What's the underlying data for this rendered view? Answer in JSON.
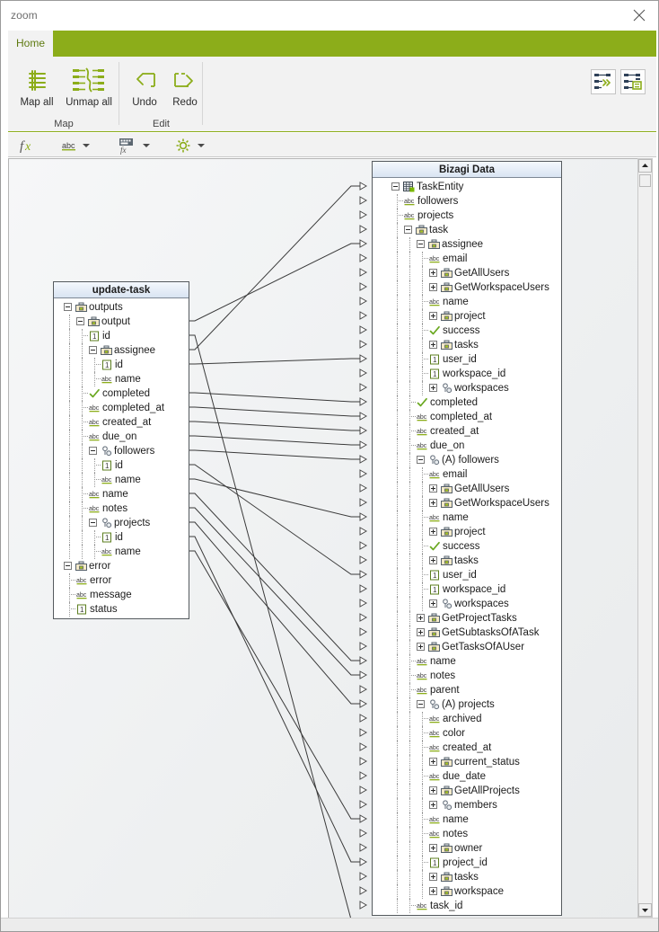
{
  "window": {
    "title": "zoom",
    "close_label": "close-window"
  },
  "ribbon": {
    "tabs": [
      {
        "label": "Home",
        "active": true
      }
    ],
    "groups": [
      {
        "title": "Map",
        "buttons": [
          {
            "label": "Map all",
            "icon": "map-all-icon"
          },
          {
            "label": "Unmap all",
            "icon": "unmap-all-icon"
          }
        ]
      },
      {
        "title": "Edit",
        "buttons": [
          {
            "label": "Undo",
            "icon": "undo-icon"
          },
          {
            "label": "Redo",
            "icon": "redo-icon"
          }
        ]
      }
    ],
    "right_buttons": [
      {
        "icon": "auto-map-icon"
      },
      {
        "icon": "show-grid-icon"
      }
    ]
  },
  "toolstrip": {
    "items": [
      {
        "icon": "fx-icon",
        "has_caret": false
      },
      {
        "icon": "abc-text-icon",
        "has_caret": true
      },
      {
        "icon": "expression-icon",
        "has_caret": true
      },
      {
        "icon": "gear-icon",
        "has_caret": true
      }
    ]
  },
  "source_panel": {
    "title": "update-task",
    "rows": [
      {
        "label": "outputs",
        "depth": 0,
        "icon": "briefcase",
        "toggle": "minus",
        "last": false
      },
      {
        "label": "output",
        "depth": 1,
        "icon": "briefcase",
        "toggle": "minus",
        "last": false
      },
      {
        "label": "id",
        "depth": 2,
        "icon": "number",
        "toggle": "none",
        "last": false
      },
      {
        "label": "assignee",
        "depth": 2,
        "icon": "briefcase",
        "toggle": "minus",
        "last": false
      },
      {
        "label": "id",
        "depth": 3,
        "icon": "number",
        "toggle": "none",
        "last": false
      },
      {
        "label": "name",
        "depth": 3,
        "icon": "abc",
        "toggle": "none",
        "last": true
      },
      {
        "label": "completed",
        "depth": 2,
        "icon": "check",
        "toggle": "none",
        "last": false
      },
      {
        "label": "completed_at",
        "depth": 2,
        "icon": "abc",
        "toggle": "none",
        "last": false
      },
      {
        "label": "created_at",
        "depth": 2,
        "icon": "abc",
        "toggle": "none",
        "last": false
      },
      {
        "label": "due_on",
        "depth": 2,
        "icon": "abc",
        "toggle": "none",
        "last": false
      },
      {
        "label": "followers",
        "depth": 2,
        "icon": "people",
        "toggle": "minus",
        "last": false
      },
      {
        "label": "id",
        "depth": 3,
        "icon": "number",
        "toggle": "none",
        "last": false
      },
      {
        "label": "name",
        "depth": 3,
        "icon": "abc",
        "toggle": "none",
        "last": true
      },
      {
        "label": "name",
        "depth": 2,
        "icon": "abc",
        "toggle": "none",
        "last": false
      },
      {
        "label": "notes",
        "depth": 2,
        "icon": "abc",
        "toggle": "none",
        "last": true
      },
      {
        "label": "projects",
        "depth": 2,
        "icon": "people",
        "toggle": "minus",
        "last": false
      },
      {
        "label": "id",
        "depth": 3,
        "icon": "number",
        "toggle": "none",
        "last": false
      },
      {
        "label": "name",
        "depth": 3,
        "icon": "abc",
        "toggle": "none",
        "last": true
      },
      {
        "label": "error",
        "depth": 0,
        "icon": "briefcase",
        "toggle": "minus",
        "last": false
      },
      {
        "label": "error",
        "depth": 1,
        "icon": "abc",
        "toggle": "none",
        "last": false
      },
      {
        "label": "message",
        "depth": 1,
        "icon": "abc",
        "toggle": "none",
        "last": false
      },
      {
        "label": "status",
        "depth": 1,
        "icon": "number",
        "toggle": "none",
        "last": true
      }
    ]
  },
  "target_panel": {
    "title": "Bizagi Data",
    "rows": [
      {
        "label": "TaskEntity",
        "depth": 0,
        "icon": "entity",
        "toggle": "minus",
        "last": false
      },
      {
        "label": "followers",
        "depth": 1,
        "icon": "abc",
        "toggle": "none",
        "last": false
      },
      {
        "label": "projects",
        "depth": 1,
        "icon": "abc",
        "toggle": "none",
        "last": true
      },
      {
        "label": "task",
        "depth": 1,
        "icon": "briefcase",
        "toggle": "minus",
        "last": false
      },
      {
        "label": "assignee",
        "depth": 2,
        "icon": "briefcase",
        "toggle": "minus",
        "last": false
      },
      {
        "label": "email",
        "depth": 3,
        "icon": "abc",
        "toggle": "none",
        "last": false
      },
      {
        "label": "GetAllUsers",
        "depth": 3,
        "icon": "briefcase",
        "toggle": "plus",
        "last": false
      },
      {
        "label": "GetWorkspaceUsers",
        "depth": 3,
        "icon": "briefcase",
        "toggle": "plus",
        "last": false
      },
      {
        "label": "name",
        "depth": 3,
        "icon": "abc",
        "toggle": "none",
        "last": false
      },
      {
        "label": "project",
        "depth": 3,
        "icon": "briefcase",
        "toggle": "plus",
        "last": false
      },
      {
        "label": "success",
        "depth": 3,
        "icon": "check",
        "toggle": "none",
        "last": false
      },
      {
        "label": "tasks",
        "depth": 3,
        "icon": "briefcase",
        "toggle": "plus",
        "last": false
      },
      {
        "label": "user_id",
        "depth": 3,
        "icon": "number",
        "toggle": "none",
        "last": false
      },
      {
        "label": "workspace_id",
        "depth": 3,
        "icon": "number",
        "toggle": "none",
        "last": true
      },
      {
        "label": "workspaces",
        "depth": 3,
        "icon": "people",
        "toggle": "plus",
        "last": false
      },
      {
        "label": "completed",
        "depth": 2,
        "icon": "check",
        "toggle": "none",
        "last": false
      },
      {
        "label": "completed_at",
        "depth": 2,
        "icon": "abc",
        "toggle": "none",
        "last": false
      },
      {
        "label": "created_at",
        "depth": 2,
        "icon": "abc",
        "toggle": "none",
        "last": false
      },
      {
        "label": "due_on",
        "depth": 2,
        "icon": "abc",
        "toggle": "none",
        "last": false
      },
      {
        "label": "(A) followers",
        "depth": 2,
        "icon": "people",
        "toggle": "minus",
        "last": false
      },
      {
        "label": "email",
        "depth": 3,
        "icon": "abc",
        "toggle": "none",
        "last": false
      },
      {
        "label": "GetAllUsers",
        "depth": 3,
        "icon": "briefcase",
        "toggle": "plus",
        "last": false
      },
      {
        "label": "GetWorkspaceUsers",
        "depth": 3,
        "icon": "briefcase",
        "toggle": "plus",
        "last": false
      },
      {
        "label": "name",
        "depth": 3,
        "icon": "abc",
        "toggle": "none",
        "last": false
      },
      {
        "label": "project",
        "depth": 3,
        "icon": "briefcase",
        "toggle": "plus",
        "last": false
      },
      {
        "label": "success",
        "depth": 3,
        "icon": "check",
        "toggle": "none",
        "last": false
      },
      {
        "label": "tasks",
        "depth": 3,
        "icon": "briefcase",
        "toggle": "plus",
        "last": false
      },
      {
        "label": "user_id",
        "depth": 3,
        "icon": "number",
        "toggle": "none",
        "last": false
      },
      {
        "label": "workspace_id",
        "depth": 3,
        "icon": "number",
        "toggle": "none",
        "last": true
      },
      {
        "label": "workspaces",
        "depth": 3,
        "icon": "people",
        "toggle": "plus",
        "last": false
      },
      {
        "label": "GetProjectTasks",
        "depth": 2,
        "icon": "briefcase",
        "toggle": "plus",
        "last": false
      },
      {
        "label": "GetSubtasksOfATask",
        "depth": 2,
        "icon": "briefcase",
        "toggle": "plus",
        "last": false
      },
      {
        "label": "GetTasksOfAUser",
        "depth": 2,
        "icon": "briefcase",
        "toggle": "plus",
        "last": false
      },
      {
        "label": "name",
        "depth": 2,
        "icon": "abc",
        "toggle": "none",
        "last": false
      },
      {
        "label": "notes",
        "depth": 2,
        "icon": "abc",
        "toggle": "none",
        "last": false
      },
      {
        "label": "parent",
        "depth": 2,
        "icon": "abc",
        "toggle": "none",
        "last": false
      },
      {
        "label": "(A) projects",
        "depth": 2,
        "icon": "people",
        "toggle": "minus",
        "last": false
      },
      {
        "label": "archived",
        "depth": 3,
        "icon": "abc",
        "toggle": "none",
        "last": false
      },
      {
        "label": "color",
        "depth": 3,
        "icon": "abc",
        "toggle": "none",
        "last": false
      },
      {
        "label": "created_at",
        "depth": 3,
        "icon": "abc",
        "toggle": "none",
        "last": false
      },
      {
        "label": "current_status",
        "depth": 3,
        "icon": "briefcase",
        "toggle": "plus",
        "last": false
      },
      {
        "label": "due_date",
        "depth": 3,
        "icon": "abc",
        "toggle": "none",
        "last": false
      },
      {
        "label": "GetAllProjects",
        "depth": 3,
        "icon": "briefcase",
        "toggle": "plus",
        "last": false
      },
      {
        "label": "members",
        "depth": 3,
        "icon": "people",
        "toggle": "plus",
        "last": false
      },
      {
        "label": "name",
        "depth": 3,
        "icon": "abc",
        "toggle": "none",
        "last": false
      },
      {
        "label": "notes",
        "depth": 3,
        "icon": "abc",
        "toggle": "none",
        "last": false
      },
      {
        "label": "owner",
        "depth": 3,
        "icon": "briefcase",
        "toggle": "plus",
        "last": false
      },
      {
        "label": "project_id",
        "depth": 3,
        "icon": "number",
        "toggle": "none",
        "last": true
      },
      {
        "label": "tasks",
        "depth": 3,
        "icon": "briefcase",
        "toggle": "plus",
        "last": false
      },
      {
        "label": "workspace",
        "depth": 3,
        "icon": "briefcase",
        "toggle": "plus",
        "last": false
      },
      {
        "label": "task_id",
        "depth": 2,
        "icon": "abc",
        "toggle": "none",
        "last": true
      }
    ]
  },
  "mappings": [
    {
      "from": 1,
      "to": 4
    },
    {
      "from": 3,
      "to": 0
    },
    {
      "from": 4,
      "to": 12
    },
    {
      "from": 6,
      "to": 15
    },
    {
      "from": 7,
      "to": 16
    },
    {
      "from": 8,
      "to": 17
    },
    {
      "from": 9,
      "to": 18
    },
    {
      "from": 10,
      "to": 19
    },
    {
      "from": 11,
      "to": 27
    },
    {
      "from": 12,
      "to": 23
    },
    {
      "from": 13,
      "to": 33
    },
    {
      "from": 14,
      "to": 34
    },
    {
      "from": 15,
      "to": 36
    },
    {
      "from": 16,
      "to": 47
    },
    {
      "from": 17,
      "to": 44
    },
    {
      "from": 2,
      "to": 51
    }
  ],
  "colors": {
    "ribbon_green": "#8cad1a",
    "tab_text": "#5e7a10",
    "panel_header": "#d9e4f2",
    "canvas": "#eef0f1"
  }
}
